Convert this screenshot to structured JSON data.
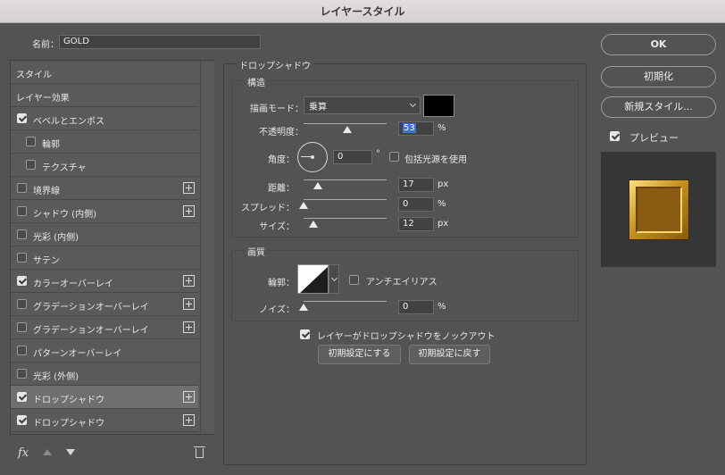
{
  "window": {
    "title": "レイヤースタイル"
  },
  "name_field": {
    "label": "名前：",
    "value": "GOLD"
  },
  "styles_list": {
    "items": [
      {
        "label": "スタイル",
        "checkbox": false,
        "checked": false,
        "plus": false,
        "indent": false,
        "selected": false
      },
      {
        "label": "レイヤー効果",
        "checkbox": false,
        "checked": false,
        "plus": false,
        "indent": false,
        "selected": false
      },
      {
        "label": "ベベルとエンボス",
        "checkbox": true,
        "checked": true,
        "plus": false,
        "indent": false,
        "selected": false
      },
      {
        "label": "輪郭",
        "checkbox": true,
        "checked": false,
        "plus": false,
        "indent": true,
        "selected": false
      },
      {
        "label": "テクスチャ",
        "checkbox": true,
        "checked": false,
        "plus": false,
        "indent": true,
        "selected": false
      },
      {
        "label": "境界線",
        "checkbox": true,
        "checked": false,
        "plus": true,
        "indent": false,
        "selected": false
      },
      {
        "label": "シャドウ (内側)",
        "checkbox": true,
        "checked": false,
        "plus": true,
        "indent": false,
        "selected": false
      },
      {
        "label": "光彩 (内側)",
        "checkbox": true,
        "checked": false,
        "plus": false,
        "indent": false,
        "selected": false
      },
      {
        "label": "サテン",
        "checkbox": true,
        "checked": false,
        "plus": false,
        "indent": false,
        "selected": false
      },
      {
        "label": "カラーオーバーレイ",
        "checkbox": true,
        "checked": true,
        "plus": true,
        "indent": false,
        "selected": false
      },
      {
        "label": "グラデーションオーバーレイ",
        "checkbox": true,
        "checked": false,
        "plus": true,
        "indent": false,
        "selected": false
      },
      {
        "label": "グラデーションオーバーレイ",
        "checkbox": true,
        "checked": false,
        "plus": true,
        "indent": false,
        "selected": false
      },
      {
        "label": "パターンオーバーレイ",
        "checkbox": true,
        "checked": false,
        "plus": false,
        "indent": false,
        "selected": false
      },
      {
        "label": "光彩 (外側)",
        "checkbox": true,
        "checked": false,
        "plus": false,
        "indent": false,
        "selected": false
      },
      {
        "label": "ドロップシャドウ",
        "checkbox": true,
        "checked": true,
        "plus": true,
        "indent": false,
        "selected": true
      },
      {
        "label": "ドロップシャドウ",
        "checkbox": true,
        "checked": true,
        "plus": true,
        "indent": false,
        "selected": false
      }
    ],
    "toolbar": {
      "fx_label": "fx",
      "icons": [
        "fx-icon",
        "move-up-icon",
        "move-down-icon",
        "trash-icon"
      ]
    }
  },
  "drop_shadow": {
    "section_title": "ドロップシャドウ",
    "structure": {
      "title": "構造",
      "blend_mode_label": "描画モード：",
      "blend_mode_value": "乗算",
      "shadow_color": "#000000",
      "opacity_label": "不透明度：",
      "opacity_value": "53",
      "opacity_unit": "%",
      "opacity_level": 53,
      "angle_label": "角度：",
      "angle_value": "0",
      "angle_unit": "°",
      "global_light_label": "包括光源を使用",
      "global_light_checked": false,
      "distance_label": "距離：",
      "distance_value": "17",
      "distance_unit": "px",
      "distance_level": 17,
      "spread_label": "スプレッド：",
      "spread_value": "0",
      "spread_unit": "%",
      "spread_level": 0,
      "size_label": "サイズ：",
      "size_value": "12",
      "size_unit": "px",
      "size_level": 12
    },
    "quality": {
      "title": "画質",
      "contour_label": "輪郭：",
      "antialias_label": "アンチエイリアス",
      "antialias_checked": false,
      "noise_label": "ノイズ：",
      "noise_value": "0",
      "noise_unit": "%",
      "noise_level": 0
    },
    "knockout_label": "レイヤーがドロップシャドウをノックアウト",
    "knockout_checked": true,
    "make_default_label": "初期設定にする",
    "reset_default_label": "初期設定に戻す"
  },
  "actions": {
    "ok_label": "OK",
    "reset_label": "初期化",
    "new_style_label": "新規スタイル...",
    "preview_label": "プレビュー",
    "preview_checked": true
  }
}
